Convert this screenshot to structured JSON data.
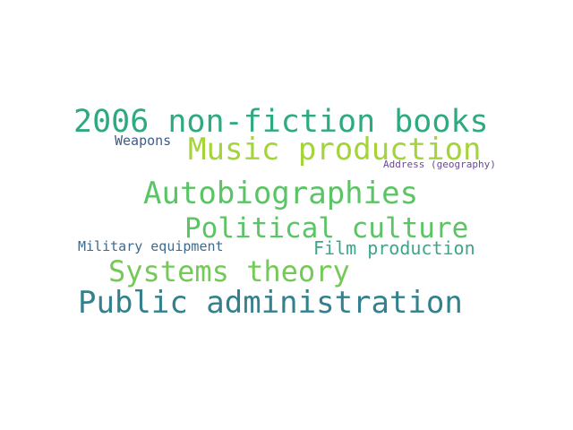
{
  "words": [
    {
      "text": "2006 non-fiction books",
      "color": "#2eaa80"
    },
    {
      "text": "Music production",
      "color": "#a5d33a"
    },
    {
      "text": "Autobiographies",
      "color": "#5bc465"
    },
    {
      "text": "Political culture",
      "color": "#5bc465"
    },
    {
      "text": "Systems theory",
      "color": "#74c958"
    },
    {
      "text": "Public administration",
      "color": "#33808e"
    },
    {
      "text": "Film production",
      "color": "#3aa78a"
    },
    {
      "text": "Weapons",
      "color": "#3b5c8c"
    },
    {
      "text": "Military equipment",
      "color": "#3d6a8f"
    },
    {
      "text": "Address (geography)",
      "color": "#6b4a96"
    }
  ]
}
